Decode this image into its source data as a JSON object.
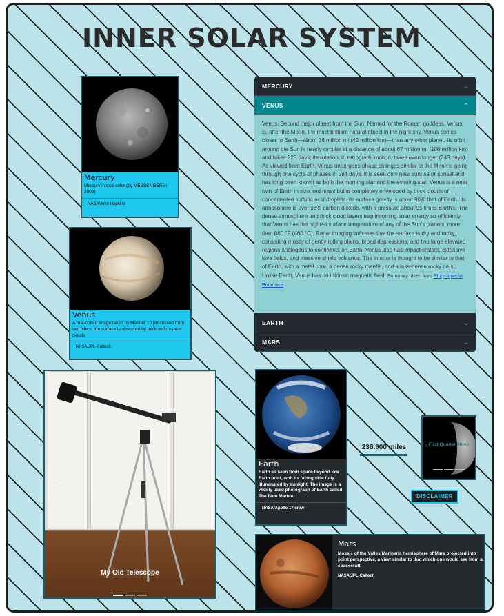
{
  "page": {
    "title": "INNER SOLAR SYSTEM"
  },
  "mercury_card": {
    "name": "Mercury",
    "description": "Mercury in true color (by MESSENGER in 2008)",
    "credit": "NASA/John Hopkins"
  },
  "venus_card": {
    "name": "Venus",
    "description": "A real-colour image taken by Mariner 10 processed from two filters, the surface is obscured by thick sulfuric-acid clouds",
    "credit": "NASA/JPL-Caltech"
  },
  "earth_card": {
    "name": "Earth",
    "description": "Earth as seen from space beyond low Earth orbit, with its facing side fully illuminated by sunlight. The image is a widely used photograph of Earth called The Blue Marble.",
    "credit": "NASA/Apollo 17 crew"
  },
  "mars_card": {
    "name": "Mars",
    "description": "Mosaic of the Valles Marineris hemisphere of Mars projected into point perspective, a view similar to that which one would see from a spacecraft.",
    "credit": "NASA/JPL-Caltech"
  },
  "accordion": {
    "items": [
      {
        "label": "MERCURY",
        "expanded": false
      },
      {
        "label": "VENUS",
        "expanded": true
      },
      {
        "label": "EARTH",
        "expanded": false
      },
      {
        "label": "MARS",
        "expanded": false
      }
    ],
    "venus_text": "Venus, Second major planet from the Sun. Named for the Roman goddess, Venus is, after the Moon, the most brilliant natural object in the night sky. Venus comes closer to Earth—about 26 million mi (42 million km)—than any other planet. Its orbit around the Sun is nearly circular at a distance of about 67 million mi (108 million km) and takes 225 days; its rotation, in retrograde motion, takes even longer (243 days). As viewed from Earth, Venus undergoes phase changes similar to the Moon's, going through one cycle of phases in 584 days. It is seen only near sunrise or sunset and has long been known as both the morning star and the evening star. Venus is a near twin of Earth in size and mass but is completely enveloped by thick clouds of concentrated sulfuric acid droplets. Its surface gravity is about 90% that of Earth. Its atmosphere is over 96% carbon dioxide, with a pressure about 95 times Earth's. The dense atmosphere and thick cloud layers trap incoming solar energy so efficiently that Venus has the highest surface temperature of any of the Sun's planets, more than 860 °F (460 °C). Radar imaging indicates that the surface is dry and rocky, consisting mostly of gently rolling plains, broad depressions, and two large elevated regions analogous to continents on Earth; Venus also has impact craters, extensive lava fields, and massive shield volcanos. The interior is thought to be similar to that of Earth, with a metal core, a dense rocky mantle, and a less-dense rocky crust. Unlike Earth, Venus has no intrinsic magnetic field.",
    "source_prefix": "Summary taken from",
    "source_link": "Encyclopedia Britannica"
  },
  "telescope_carousel": {
    "caption": "My Old Telescope",
    "slides": 3,
    "active_slide": 1
  },
  "distance": {
    "label": "238,900 miles"
  },
  "moon_carousel": {
    "caption": "First Quarter Moon",
    "slides": 3,
    "active_slide": 1
  },
  "disclaimer": {
    "label": "DISCLAIMER"
  },
  "colors": {
    "card_cyan": "#1ec7ee",
    "accordion_active": "#00868c",
    "dark_panel": "#23292e",
    "background": "#bde3ea"
  }
}
